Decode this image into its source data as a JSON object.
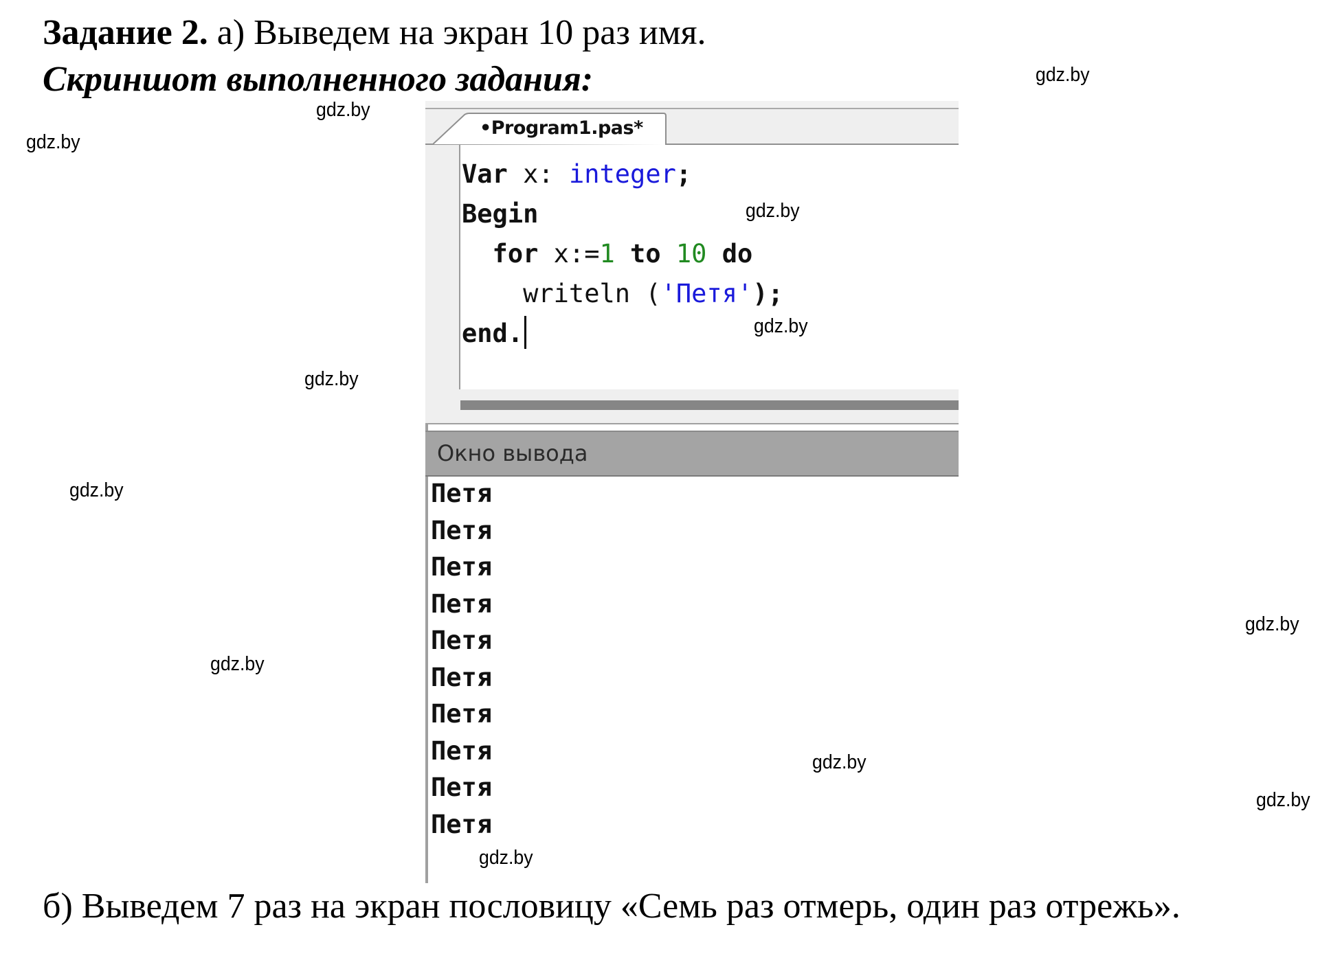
{
  "heading": {
    "task_label": "Задание 2.",
    "task_text": " а) Выведем на экран 10 раз имя.",
    "subtitle": "Скриншот выполненного задания:"
  },
  "editor": {
    "tab_title": "•Program1.pas*",
    "code_lines": [
      [
        {
          "t": "Var",
          "c": "kw"
        },
        {
          "t": " x: ",
          "c": "plain"
        },
        {
          "t": "integer",
          "c": "type"
        },
        {
          "t": ";",
          "c": "kw"
        }
      ],
      [
        {
          "t": "Begin",
          "c": "kw"
        }
      ],
      [
        {
          "t": "  for",
          "c": "kw"
        },
        {
          "t": " x:=",
          "c": "plain"
        },
        {
          "t": "1",
          "c": "num"
        },
        {
          "t": " to ",
          "c": "kw"
        },
        {
          "t": "10",
          "c": "num"
        },
        {
          "t": " do",
          "c": "kw"
        }
      ],
      [
        {
          "t": "    writeln ",
          "c": "plain"
        },
        {
          "t": "(",
          "c": "plain"
        },
        {
          "t": "'Петя'",
          "c": "str"
        },
        {
          "t": ");",
          "c": "kw"
        }
      ],
      [
        {
          "t": "end.",
          "c": "kw"
        }
      ]
    ]
  },
  "output_panel": {
    "title": "Окно вывода",
    "lines": [
      "Петя",
      "Петя",
      "Петя",
      "Петя",
      "Петя",
      "Петя",
      "Петя",
      "Петя",
      "Петя",
      "Петя"
    ]
  },
  "task_b": {
    "text": "б) Выведем 7 раз на экран пословицу «Семь раз отмерь, один раз отрежь»."
  },
  "watermark": {
    "text": "gdz.by",
    "count": 12
  },
  "colors": {
    "keyword": "#111111",
    "type": "#1a1adb",
    "number": "#218a21",
    "string": "#1a1adb",
    "output_header": "#a4a4a4"
  }
}
